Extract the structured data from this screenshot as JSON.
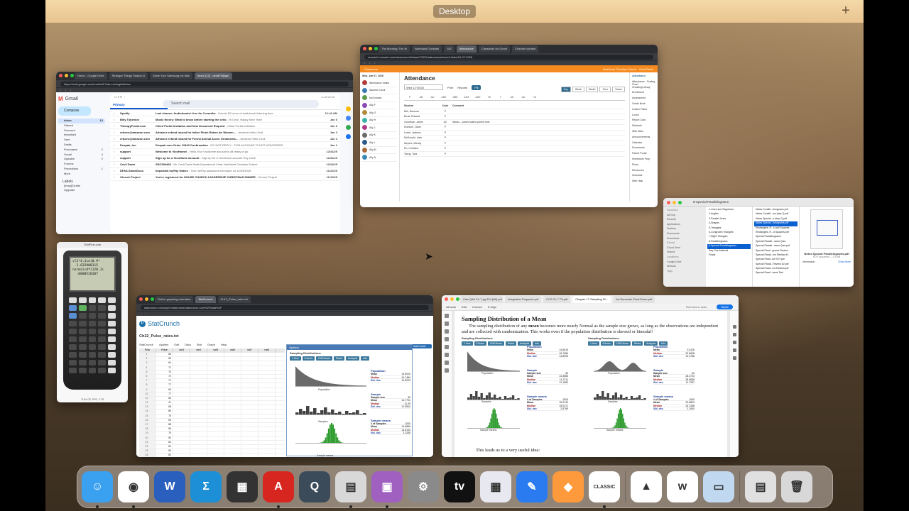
{
  "desktop": {
    "label": "Desktop",
    "plus": "+"
  },
  "gmail": {
    "tabs": [
      "Home - Google Drive",
      "Stranger Things Season 5",
      "Solve Your Samsung Ice Mak",
      "Inbox (13) - cecili79@gm"
    ],
    "url": "https://mail.google.com/mail/u/0/?tab=rm&ogbl#inbox",
    "product": "Gmail",
    "search_placeholder": "Search mail",
    "compose": "Compose",
    "page_count": "1–44 of 44",
    "folders": [
      {
        "name": "Inbox",
        "count": "13"
      },
      {
        "name": "Starred",
        "count": ""
      },
      {
        "name": "Snoozed",
        "count": ""
      },
      {
        "name": "Important",
        "count": ""
      },
      {
        "name": "Sent",
        "count": ""
      },
      {
        "name": "Drafts",
        "count": ""
      },
      {
        "name": "Purchases",
        "count": "2"
      },
      {
        "name": "Social",
        "count": "4"
      },
      {
        "name": "Updates",
        "count": "2"
      },
      {
        "name": "Forums",
        "count": ""
      },
      {
        "name": "Promotions",
        "count": "1"
      },
      {
        "name": "More",
        "count": ""
      }
    ],
    "labels_title": "Labels",
    "labels": [
      "[Imap]/Drafts",
      "Upgrade"
    ],
    "categories": [
      "Primary",
      "Promotions",
      "Social",
      "Updates"
    ],
    "rows": [
      {
        "sender": "Spotify",
        "subject": "Last chance: Audiobooks+ free for 3 months",
        "snippet": " - Unlock 15 hours of audiobook listening time",
        "date": "12:49 AM"
      },
      {
        "sender": "Billy Tobenkin",
        "subject": "Music theory: What to know before starting the cello",
        "snippet": " - Hi Cecil, Happy New Year!",
        "date": "Jan 6"
      },
      {
        "sender": "TherapyPortal.com",
        "subject": "Client Portal Invitation and New Document Request",
        "snippet": " - Client Portal Invitation",
        "date": "Jan 6"
      },
      {
        "sender": "returns@amazon.com",
        "subject": "Advance refund issued for Inlber Plush Robes for Women...",
        "snippet": " - Amazon Hello Cecil",
        "date": "Jan 3"
      },
      {
        "sender": "returns@amazon.com",
        "subject": "Advance refund issued for Forest Animal Acorn Ornaments...",
        "snippet": " - Amazon Hello Cecil",
        "date": "Jan 3"
      },
      {
        "sender": "Despair, Inc.",
        "subject": "Despair.com Order 11543 Confirmation",
        "snippet": " - DO NOT REPLY - THIS ACCOUNT IS NOT MONITORED",
        "date": "Jan 2"
      },
      {
        "sender": "support",
        "subject": "Welcome to VicoHome!",
        "snippet": " - Hello,Your Vicohome account is all ready to go",
        "date": "12/31/25"
      },
      {
        "sender": "support",
        "subject": "Sign up for a VicoHome account",
        "snippet": " - Sign up for a VicoHome account Hey cecili",
        "date": "12/31/25"
      },
      {
        "sender": "Cecil Davis",
        "subject": "SDC006469",
        "snippet": " - Mr. Cecil Davis Math Department Chair Northland Christian School",
        "date": "12/23/25"
      },
      {
        "sender": "DFAS-SmartDocs",
        "subject": "Important myPay Notice",
        "snippet": " - Your myPay password will expire on 12/03/2025",
        "date": "11/22/25"
      },
      {
        "sender": "Church Project",
        "subject": "You're registered for HOUSE CHURCH LEADERSHIP CHRISTMAS DINNER",
        "snippet": " - Church Project",
        "date": "11/19/25"
      }
    ]
  },
  "renweb": {
    "tabs": [
      "The Morning: The fe",
      "Northland Christian",
      "SIS",
      "Attendance",
      "Classwork for Geom",
      "Channel content"
    ],
    "url": "renweb1.renweb.com/classroom/#/class/17921/attendance/term/1/date/01-07-2026",
    "header_left": "Classroom",
    "header_right": "Northland Christian School · Cecil Davis",
    "date_label": "Wed, Jan 07, 2026",
    "title": "Attendance",
    "date": "Wed 1/7/2026",
    "print": "Print",
    "reports": "Reports",
    "fill": "Fill",
    "views": [
      "Day",
      "Week",
      "Month",
      "Term",
      "Scans"
    ],
    "col_heads": [
      "P",
      "AB",
      "AU",
      "ADE",
      "ABE",
      "ADA",
      "ADE",
      "TE",
      "T",
      "AE",
      "AU",
      "TA"
    ],
    "table_head": {
      "name": "Student",
      "code": "Code",
      "comment": "Comment"
    },
    "students": [
      {
        "name": "Bell, Brennan",
        "code": "P",
        "comment": ""
      },
      {
        "name": "Brust, Edward",
        "code": "P",
        "comment": ""
      },
      {
        "name": "Goodman, Jamie",
        "code": "AC",
        "comment": "Illness – parent called parent note"
      },
      {
        "name": "Hummel, Claire",
        "code": "P",
        "comment": ""
      },
      {
        "name": "Leard, Jackson",
        "code": "P",
        "comment": ""
      },
      {
        "name": "McDonald, Liam",
        "code": "P",
        "comment": ""
      },
      {
        "name": "Meyers, Wendy",
        "code": "P",
        "comment": ""
      },
      {
        "name": "Ru, Christina",
        "code": "P",
        "comment": ""
      },
      {
        "name": "Tseng, Tara",
        "code": "P",
        "comment": ""
      }
    ],
    "left_list": [
      "Attendance Intake",
      "Student Count",
      "McCroskey",
      "Ally F",
      "Ally G",
      "Ally H",
      "Ally J",
      "Ally K",
      "Ally L",
      "Ally M",
      "Ally N"
    ],
    "right_panel_head": "Attendance",
    "right_panel": [
      "Attendance · Scaling Chart",
      "Cheating/Library",
      "Enrollment",
      "Assessment",
      "Grade Book",
      "Lesson Plans",
      "Lunch",
      "Report Card",
      "Students",
      "Web Sites",
      "Announcements",
      "Calendar",
      "Documents",
      "Parent Portal",
      "Homework Prep",
      "Photo",
      "Resources",
      "Schedule",
      "Web Help"
    ]
  },
  "finder": {
    "title": "8-Special Parallelograms",
    "sidebar": [
      {
        "label": "Favorites",
        "head": true
      },
      {
        "label": "AirDrop",
        "head": false
      },
      {
        "label": "Recents",
        "head": false
      },
      {
        "label": "Applications",
        "head": false
      },
      {
        "label": "Desktop",
        "head": false
      },
      {
        "label": "Documents",
        "head": false
      },
      {
        "label": "Downloads",
        "head": false
      },
      {
        "label": "iCloud",
        "head": true
      },
      {
        "label": "iCloud Drive",
        "head": false
      },
      {
        "label": "Shared",
        "head": false
      },
      {
        "label": "Locations",
        "head": true
      },
      {
        "label": "Google Drive",
        "head": false
      },
      {
        "label": "Network",
        "head": false
      },
      {
        "label": "Tags",
        "head": true
      }
    ],
    "folders": [
      "1-Lines and Segments",
      "2-Angles",
      "3-Parallel Lines",
      "4-Shapes",
      "5-Triangles",
      "6-Congruent Triangles",
      "7-Right Triangles",
      "8-Parallelograms",
      "8-Special Parallelograms",
      "Day One Material",
      "Finals"
    ],
    "selected_folder": "8-Special Parallelograms",
    "files": [
      "Notes Conditi...ferograms.pdf",
      "Notes Conditi...ms (day 2).pdf",
      "Notes Special...s (day 2).pdf",
      "Notes Special...llelograms.pdf",
      "Rectangles, R...s and Squares",
      "Rectangles, R...d Squares.pdf",
      "Special Parallelograms",
      "Special Paralle...rams Quiz",
      "Special Paralle...rams Quiz.pdf",
      "Special Paral...grams Review",
      "Special Parall...ms Review #2",
      "Special Paral...ke KEY.pdf",
      "Special Parall...Review #2.pdf",
      "Special Paral...ms Review.pdf",
      "Special Paral...rams Test"
    ],
    "selected_file": "Notes Special...llelograms.pdf",
    "preview_name": "Notes Special Parallelograms.pdf",
    "preview_meta": "PDF document – 1.3 MB",
    "info": "Information",
    "show_more": "Show More"
  },
  "ti84": {
    "title": "TI84Plus.com",
    "screen": "√(2*4.1co(0.9*\n  1.632908115\nnormalcdf(120,1(\n  .0000520107",
    "footer": "TI-84 CE, PPC, 2.78"
  },
  "statcrunch": {
    "tabs": [
      "Online graphing calculator",
      "StatCrunch",
      "Ch12_Pulse_rates.txt"
    ],
    "url": "statcrunch.com/app/?data=www.statcrunch.com%2Fdata%2F",
    "logo": "StatCrunch",
    "file": "Ch22_Pulse_rates.txt",
    "menu": [
      "StatCrunch",
      "Applets",
      "Edit",
      "Data",
      "Stat",
      "Graph",
      "Help"
    ],
    "cols": [
      "Row",
      "Pulse",
      "var3",
      "var4",
      "var5",
      "var6",
      "var7",
      "var8"
    ],
    "rows": [
      [
        "1",
        "66"
      ],
      [
        "2",
        "56"
      ],
      [
        "3",
        "64"
      ],
      [
        "4",
        "72"
      ],
      [
        "5",
        "75"
      ],
      [
        "6",
        "72"
      ],
      [
        "7",
        "71"
      ],
      [
        "8",
        "77"
      ],
      [
        "9",
        "63"
      ],
      [
        "10",
        "77"
      ],
      [
        "11",
        "63"
      ],
      [
        "12",
        "47"
      ],
      [
        "13",
        "68"
      ],
      [
        "14",
        "85"
      ],
      [
        "15",
        "76"
      ],
      [
        "16",
        "59"
      ],
      [
        "17",
        "88"
      ],
      [
        "18",
        "56"
      ],
      [
        "19",
        "75"
      ],
      [
        "20",
        "90"
      ],
      [
        "21",
        "64"
      ],
      [
        "22",
        "62"
      ],
      [
        "23",
        "59"
      ],
      [
        "24",
        "60"
      ]
    ],
    "options_title": "Options",
    "panel_title": "Sampling Distributions",
    "btns": [
      "1 time",
      "5 times",
      "1000 times",
      "Reset",
      "Analysis",
      "Info"
    ],
    "population": {
      "mean": "14.6519",
      "median": "10.7484",
      "sd": "14.8293"
    },
    "sample": {
      "size": "30",
      "mean": "14.7794",
      "median": "11.25",
      "sd": "12.6564"
    },
    "sample_means": {
      "count": "1000",
      "mean": "14.6866",
      "median": "14.6144",
      "sd": "2.2265"
    },
    "right_label": "StatCrunch"
  },
  "acrobat": {
    "tabs": [
      "Calc Q4A Ch 7.pg 324 (88).pdf",
      "Integration Polypoint.pdf",
      "CC2 Ch 7 TV.pdf",
      "Chapter 17 Sampling Di...",
      "1st Semester Final Exam.pdf"
    ],
    "toolbar": [
      "All tools",
      "Edit",
      "Convert",
      "E-Sign"
    ],
    "find": "Find text or tools",
    "share": "Share",
    "heading": "Sampling Distribution of a Mean",
    "para_pre": "The sampling distribution of any ",
    "para_bold": "mean",
    "para_post": " becomes more nearly Normal as the sample size grows, as long as the observations are independent and are collected with randomization. This works even if the population distribution is skewed or bimodal!",
    "closing": "This leads us to a very useful idea:",
    "left": {
      "population": {
        "mean": "14.6519",
        "median": "10.7484",
        "sd": "14.8293"
      },
      "sample": {
        "size": "30",
        "mean": "14.3583",
        "median": "11.2711",
        "sd": "11.1582"
      },
      "sample_means": {
        "count": "1000",
        "mean": "15.0740",
        "median": "15.0171",
        "sd": "2.6799"
      }
    },
    "right": {
      "population": {
        "mean": "23.426",
        "median": "22.5608",
        "sd": "12.3768"
      },
      "sample": {
        "size": "30",
        "mean": "26.2723",
        "median": "28.9836",
        "sd": "11.7287"
      },
      "sample_means": {
        "count": "1000",
        "mean": "23.6803",
        "median": "23.7436",
        "sd": "2.2940"
      }
    }
  },
  "labels": {
    "population": "Population",
    "sample": "Sample",
    "sample_means": "Sample means",
    "mean": "Mean",
    "median": "Median",
    "sd": "Std. dev.",
    "size": "Sample size",
    "count": "# of Samples",
    "pop_axis": "Population",
    "samp_axis": "Samples",
    "means_axis": "Sample means"
  },
  "dock": {
    "icons": [
      {
        "name": "finder-icon",
        "bg": "#3aa0f0",
        "glyph": "☺",
        "running": true
      },
      {
        "name": "chrome-icon",
        "bg": "#ffffff",
        "glyph": "◉",
        "running": true
      },
      {
        "name": "word-icon",
        "bg": "#2b5fbd",
        "glyph": "W",
        "running": false
      },
      {
        "name": "sum-icon",
        "bg": "#1d8fd6",
        "glyph": "Σ",
        "running": false
      },
      {
        "name": "calculator-icon",
        "bg": "#333333",
        "glyph": "▦",
        "running": false
      },
      {
        "name": "acrobat-icon",
        "bg": "#d7261f",
        "glyph": "A",
        "running": true
      },
      {
        "name": "quicktime-icon",
        "bg": "#3c4b5a",
        "glyph": "Q",
        "running": false
      },
      {
        "name": "ti-calculator-icon",
        "bg": "#d8d8d8",
        "glyph": "▤",
        "running": true
      },
      {
        "name": "preview-icon",
        "bg": "#a060c0",
        "glyph": "▣",
        "running": true
      },
      {
        "name": "system-settings-icon",
        "bg": "#8a8a8a",
        "glyph": "⚙",
        "running": false
      },
      {
        "name": "apple-tv-icon",
        "bg": "#111111",
        "glyph": "tv",
        "running": false
      },
      {
        "name": "launchpad-icon",
        "bg": "#e8e8f0",
        "glyph": "▦",
        "running": false
      },
      {
        "name": "drawing-app-icon",
        "bg": "#2a7af0",
        "glyph": "✎",
        "running": false
      },
      {
        "name": "color-app-icon",
        "bg": "#ff9a3c",
        "glyph": "◆",
        "running": false
      },
      {
        "name": "geogebra-classic-icon",
        "bg": "#ffffff",
        "glyph": "CLASSIC",
        "running": true
      },
      {
        "name": "google-drive-icon",
        "bg": "#ffffff",
        "glyph": "▲",
        "running": false
      },
      {
        "name": "webex-icon",
        "bg": "#ffffff",
        "glyph": "w",
        "running": false
      },
      {
        "name": "photos-icon",
        "bg": "#c0d8f0",
        "glyph": "▭",
        "running": false
      },
      {
        "name": "documents-stack-icon",
        "bg": "#e0e0e0",
        "glyph": "▤",
        "running": false
      },
      {
        "name": "trash-icon",
        "bg": "#d8d8d8",
        "glyph": "🗑",
        "running": false
      }
    ]
  }
}
